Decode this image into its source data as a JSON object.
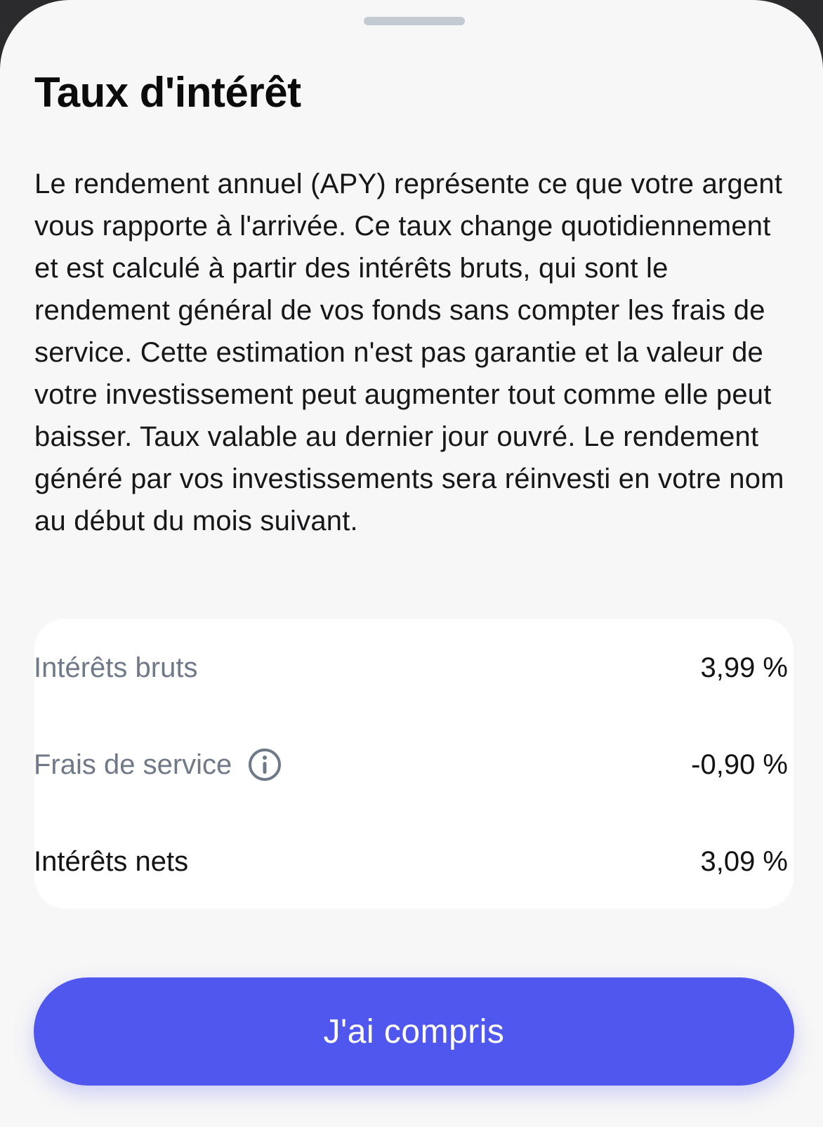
{
  "sheet": {
    "title": "Taux d'intérêt",
    "description": "Le rendement annuel (APY) représente ce que votre argent vous rapporte à l'arrivée. Ce taux change quotidiennement et est calculé à partir des intérêts bruts, qui sont le rendement général de vos fonds sans compter les frais de service. Cette estimation n'est pas garantie et la valeur de votre investissement peut augmenter tout comme elle peut baisser. Taux valable au dernier jour ouvré. Le rendement généré par vos investissements sera réinvesti en votre nom au début du mois suivant."
  },
  "rates": [
    {
      "label": "Intérêts bruts",
      "value": "3,99 %"
    },
    {
      "label": "Frais de service",
      "value": "-0,90 %",
      "icon": "info-icon"
    },
    {
      "label": "Intérêts nets",
      "value": "3,09 %"
    }
  ],
  "cta": {
    "label": "J'ai compris"
  },
  "colors": {
    "accent": "#5057ef",
    "muted_text": "#6f7988",
    "sheet_background": "#f7f7f7",
    "card_background": "#ffffff"
  }
}
